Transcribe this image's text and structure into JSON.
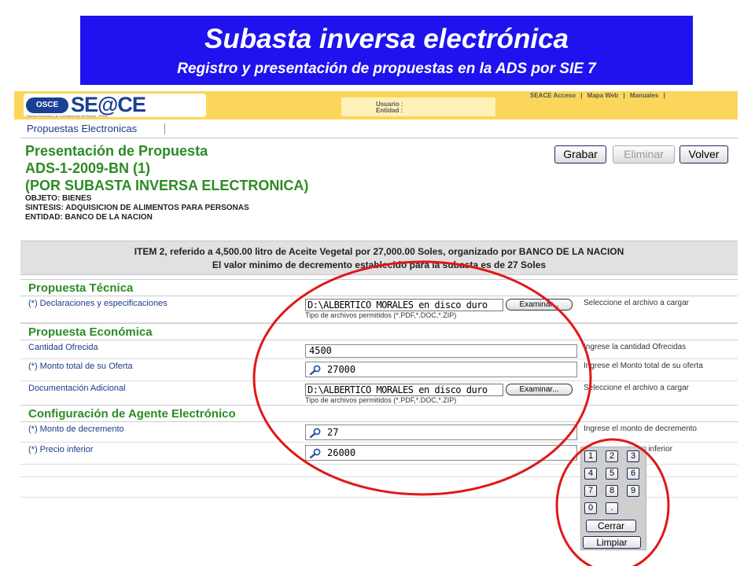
{
  "slide": {
    "title": "Subasta inversa electrónica",
    "subtitle": "Registro y presentación de propuestas en la ADS por SIE    7"
  },
  "header": {
    "logo_osce": "OSCE",
    "logo_seace": "SE@CE",
    "logo_sub": "Sistema Electrónico de Contrataciones del Estado - PERÚ",
    "user_label": "Usuario :",
    "entity_label": "Entidad :",
    "nav": [
      "SEACE Acceso",
      "|",
      "Mapa Web",
      "|",
      "Manuales",
      "|"
    ],
    "accent_color": "#fbd65a"
  },
  "tabs": {
    "active": "Propuestas Electronicas"
  },
  "page": {
    "title": "Presentación de Propuesta",
    "code": "ADS-1-2009-BN (1)",
    "mode": "(POR SUBASTA INVERSA ELECTRONICA)",
    "objeto": "OBJETO: BIENES",
    "sintesis": "SINTESIS: ADQUISICION DE ALIMENTOS PARA PERSONAS",
    "entidad": "ENTIDAD: BANCO DE LA NACION"
  },
  "toolbar": {
    "grabar": "Grabar",
    "eliminar": "Eliminar",
    "volver": "Volver"
  },
  "item": {
    "line1": "ITEM 2, referido a 4,500.00 litro de Aceite Vegetal  por 27,000.00 Soles, organizado por BANCO DE LA NACION",
    "line2": "El valor minimo de decremento establecido para la subasta es de 27 Soles"
  },
  "tecnica": {
    "title": "Propuesta Técnica",
    "label": "(*) Declaraciones y especificaciones",
    "file_value": "D:\\ALBERTICO MORALES en disco duro",
    "browse": "Examinar...",
    "allowed": "Tipo de archivos permitidos (*.PDF,*.DOC,*.ZIP)",
    "hint": "Seleccione el archivo a cargar"
  },
  "economica": {
    "title": "Propuesta Económica",
    "cantidad_label": "Cantidad Ofrecida",
    "cantidad_value": "4500",
    "cantidad_hint": "Ingrese la cantidad Ofrecidas",
    "monto_label": "(*) Monto total de su Oferta",
    "monto_value": "27000",
    "monto_hint": "Ingrese el Monto total de su oferta",
    "doc_label": "Documentación Adicional",
    "doc_value": "D:\\ALBERTICO MORALES en disco duro",
    "doc_browse": "Examinar...",
    "doc_allowed": "Tipo de archivos permitidos (*.PDF,*.DOC,*.ZIP)",
    "doc_hint": "Seleccione el archivo a cargar"
  },
  "agente": {
    "title": "Configuración de Agente Electrónico",
    "decremento_label": "(*) Monto de decremento",
    "decremento_value": "27",
    "decremento_hint": "Ingrese el monto de decremento",
    "precio_label": "(*) Precio inferior",
    "precio_value": "26000",
    "precio_hint": "e inferior"
  },
  "keypad": {
    "keys": [
      "1",
      "2",
      "3",
      "4",
      "5",
      "6",
      "7",
      "8",
      "9",
      "0",
      "."
    ],
    "cerrar": "Cerrar",
    "limpiar": "Limpiar"
  },
  "colors": {
    "banner": "#1f12ee",
    "section_green": "#2c8b25",
    "label_blue": "#1c3c8c",
    "annotation_red": "#e01818"
  }
}
